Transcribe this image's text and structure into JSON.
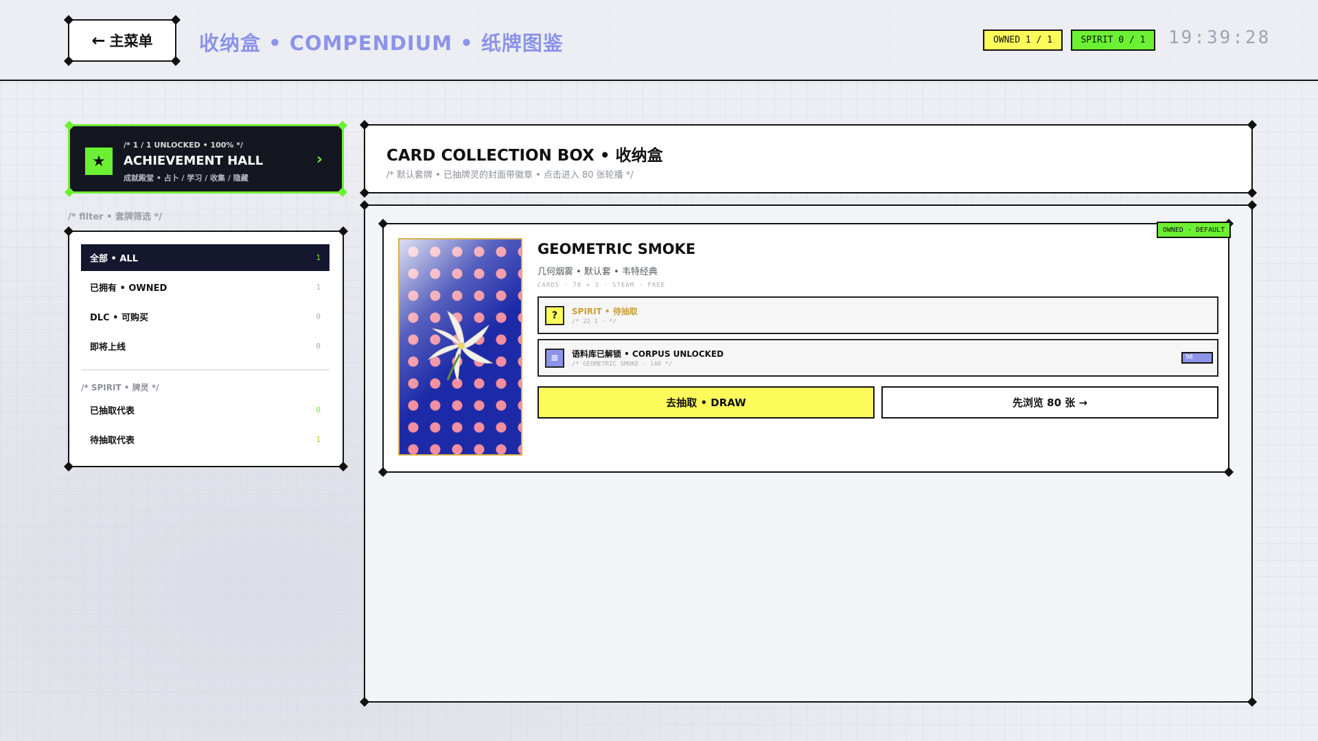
{
  "topbar": {
    "back_label": "主菜单",
    "breadcrumb": "收纳盒 • COMPENDIUM • 纸牌图鉴",
    "owned_pill": "OWNED 1 / 1",
    "spirit_pill": "SPIRIT 0 / 1",
    "clock": "19:39:28"
  },
  "achievement": {
    "status": "/* 1 / 1 UNLOCKED • 100% */",
    "title": "ACHIEVEMENT HALL",
    "subtitle": "成就殿堂 • 占卜 / 学习 / 收集 / 隐藏"
  },
  "filter": {
    "caption": "/* filter • 套牌筛选 */",
    "items": [
      {
        "label": "全部 • ALL",
        "count": "1"
      },
      {
        "label": "已拥有 • OWNED",
        "count": "1"
      },
      {
        "label": "DLC • 可购买",
        "count": "0"
      },
      {
        "label": "即将上线",
        "count": "0"
      }
    ],
    "spirit_caption": "/* SPIRIT • 牌灵 */",
    "spirit_items": [
      {
        "label": "已抽取代表",
        "count": "0"
      },
      {
        "label": "待抽取代表",
        "count": "1"
      }
    ]
  },
  "header": {
    "title": "CARD COLLECTION BOX • 收纳盒",
    "subtitle": "/* 默认套牌 • 已抽牌灵的封面带徽章 • 点击进入 80 张轮播 */"
  },
  "deck": {
    "badge": "OWNED · DEFAULT",
    "title": "GEOMETRIC SMOKE",
    "subtitle": "几何烟雾 • 默认套 • 韦特经典",
    "meta": "CARDS · 78 + 3 · STEAM · FREE",
    "spirit_title": "SPIRIT • 待抽取",
    "spirit_meta": "/* 22 1 · */",
    "corpus_title": "语料库已解锁 • CORPUS UNLOCKED",
    "corpus_meta": "/* GEOMETRIC SMOKE · 140 */",
    "corpus_progress": "98",
    "draw_label": "去抽取 • DRAW",
    "browse_label": "先浏览 80 张 →"
  },
  "colors": {
    "accent_green": "#6cf033",
    "accent_yellow": "#fdfa5c",
    "accent_purple": "#8c94e8",
    "dark": "#14172e"
  },
  "icons": {
    "back": "arrow-left-icon",
    "achievement": "star-icon",
    "achievement_go": "chevron-right-icon",
    "spirit": "question-icon",
    "corpus": "list-icon"
  }
}
